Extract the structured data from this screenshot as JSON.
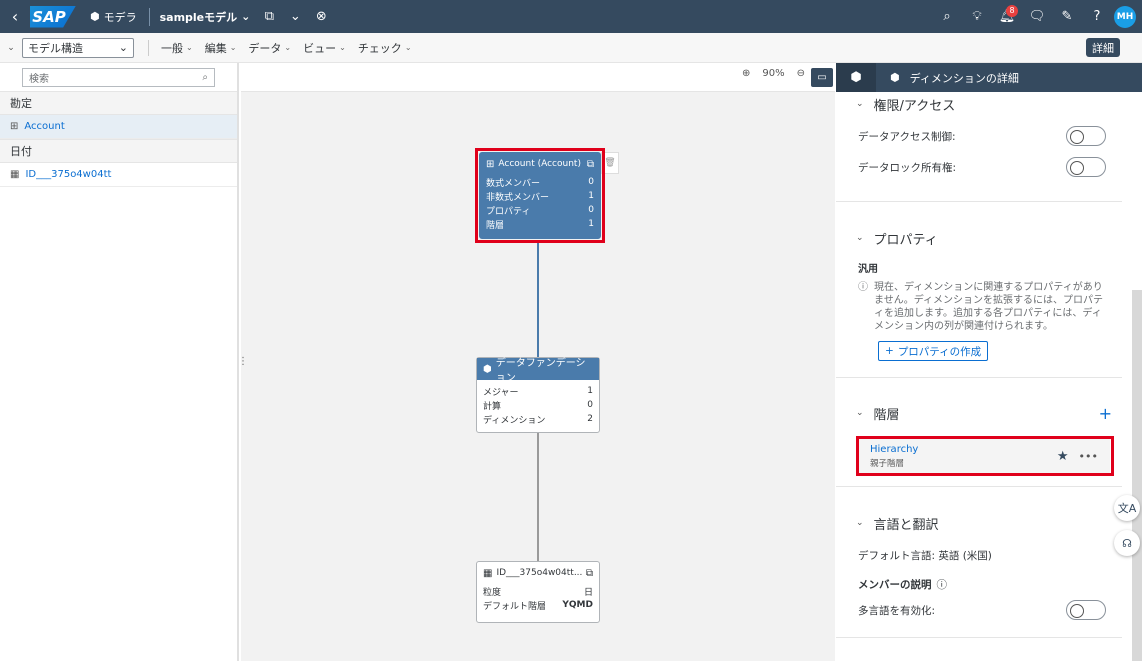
{
  "shell": {
    "logo": "SAP",
    "app_label": "モデラ",
    "model_name": "sampleモデル",
    "notification_count": "8",
    "user_initials": "MH"
  },
  "toolbar": {
    "view_select": "モデル構造",
    "menus": [
      "一般",
      "編集",
      "データ",
      "ビュー",
      "チェック"
    ],
    "detail_button": "詳細"
  },
  "left_panel": {
    "search_placeholder": "検索",
    "groups": [
      {
        "title": "勘定",
        "items": [
          "Account"
        ]
      },
      {
        "title": "日付",
        "items": [
          "ID___375o4w04tt"
        ]
      }
    ]
  },
  "canvas": {
    "zoom_level": "90%",
    "account_card": {
      "title": "Account (Account)",
      "rows": [
        {
          "label": "数式メンバー",
          "value": "0"
        },
        {
          "label": "非数式メンバー",
          "value": "1"
        },
        {
          "label": "プロパティ",
          "value": "0"
        },
        {
          "label": "階層",
          "value": "1"
        }
      ]
    },
    "foundation_card": {
      "title": "データファンデーション",
      "rows": [
        {
          "label": "メジャー",
          "value": "1"
        },
        {
          "label": "計算",
          "value": "0"
        },
        {
          "label": "ディメンション",
          "value": "2"
        }
      ]
    },
    "date_card": {
      "title": "ID___375o4w04tt...",
      "rows": [
        {
          "label": "粒度",
          "value": "日"
        },
        {
          "label": "デフォルト階層",
          "value": "YQMD"
        }
      ]
    }
  },
  "right_panel": {
    "tab_title": "ディメンションの詳細",
    "access_section": {
      "title": "権限/アクセス",
      "data_access_label": "データアクセス制御:",
      "data_lock_label": "データロック所有権:"
    },
    "property_section": {
      "title": "プロパティ",
      "general_label": "汎用",
      "info_text": "現在、ディメンションに関連するプロパティがありません。ディメンションを拡張するには、プロパティを追加します。追加する各プロパティには、ディメンション内の列が関連付けられます。",
      "create_button": "プロパティの作成"
    },
    "hierarchy_section": {
      "title": "階層",
      "item_name": "Hierarchy",
      "item_type": "親子階層"
    },
    "language_section": {
      "title": "言語と翻訳",
      "default_language": "デフォルト言語: 英語 (米国)",
      "member_desc_label": "メンバーの説明",
      "multilang_label": "多言語を有効化:"
    }
  }
}
